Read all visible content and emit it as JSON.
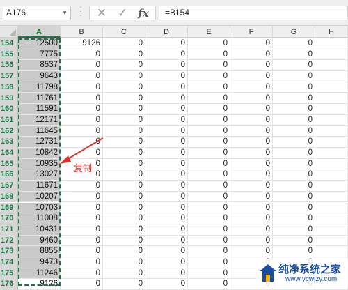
{
  "name_box": {
    "value": "A176",
    "dropdown_icon": "caret-down-icon"
  },
  "formula_bar": {
    "cancel_icon": "x-icon",
    "enter_icon": "checkmark-icon",
    "fx_label": "fx",
    "formula": "=B154"
  },
  "columns": [
    "A",
    "B",
    "C",
    "D",
    "E",
    "F",
    "G",
    "H"
  ],
  "active_column": "A",
  "rows": [
    {
      "num": "154",
      "a": "12500",
      "b": "9126",
      "c": "0",
      "d": "0",
      "e": "0",
      "f": "0",
      "g": "0"
    },
    {
      "num": "155",
      "a": "7775",
      "b": "0",
      "c": "0",
      "d": "0",
      "e": "0",
      "f": "0",
      "g": "0"
    },
    {
      "num": "156",
      "a": "8537",
      "b": "0",
      "c": "0",
      "d": "0",
      "e": "0",
      "f": "0",
      "g": "0"
    },
    {
      "num": "157",
      "a": "9643",
      "b": "0",
      "c": "0",
      "d": "0",
      "e": "0",
      "f": "0",
      "g": "0"
    },
    {
      "num": "158",
      "a": "11798",
      "b": "0",
      "c": "0",
      "d": "0",
      "e": "0",
      "f": "0",
      "g": "0"
    },
    {
      "num": "159",
      "a": "11761",
      "b": "0",
      "c": "0",
      "d": "0",
      "e": "0",
      "f": "0",
      "g": "0"
    },
    {
      "num": "160",
      "a": "11591",
      "b": "0",
      "c": "0",
      "d": "0",
      "e": "0",
      "f": "0",
      "g": "0"
    },
    {
      "num": "161",
      "a": "12171",
      "b": "0",
      "c": "0",
      "d": "0",
      "e": "0",
      "f": "0",
      "g": "0"
    },
    {
      "num": "162",
      "a": "11645",
      "b": "0",
      "c": "0",
      "d": "0",
      "e": "0",
      "f": "0",
      "g": "0"
    },
    {
      "num": "163",
      "a": "12731",
      "b": "0",
      "c": "0",
      "d": "0",
      "e": "0",
      "f": "0",
      "g": "0"
    },
    {
      "num": "164",
      "a": "10842",
      "b": "0",
      "c": "0",
      "d": "0",
      "e": "0",
      "f": "0",
      "g": "0"
    },
    {
      "num": "165",
      "a": "10935",
      "b": "0",
      "c": "0",
      "d": "0",
      "e": "0",
      "f": "0",
      "g": "0"
    },
    {
      "num": "166",
      "a": "13027",
      "b": "0",
      "c": "0",
      "d": "0",
      "e": "0",
      "f": "0",
      "g": "0"
    },
    {
      "num": "167",
      "a": "11671",
      "b": "0",
      "c": "0",
      "d": "0",
      "e": "0",
      "f": "0",
      "g": "0"
    },
    {
      "num": "168",
      "a": "10207",
      "b": "0",
      "c": "0",
      "d": "0",
      "e": "0",
      "f": "0",
      "g": "0"
    },
    {
      "num": "169",
      "a": "10703",
      "b": "0",
      "c": "0",
      "d": "0",
      "e": "0",
      "f": "0",
      "g": "0"
    },
    {
      "num": "170",
      "a": "11008",
      "b": "0",
      "c": "0",
      "d": "0",
      "e": "0",
      "f": "0",
      "g": "0"
    },
    {
      "num": "171",
      "a": "10431",
      "b": "0",
      "c": "0",
      "d": "0",
      "e": "0",
      "f": "0",
      "g": "0"
    },
    {
      "num": "172",
      "a": "9460",
      "b": "0",
      "c": "0",
      "d": "0",
      "e": "0",
      "f": "0",
      "g": "0"
    },
    {
      "num": "173",
      "a": "8855",
      "b": "0",
      "c": "0",
      "d": "0",
      "e": "0",
      "f": "0",
      "g": "0"
    },
    {
      "num": "174",
      "a": "9473",
      "b": "0",
      "c": "0",
      "d": "0",
      "e": "0",
      "f": "0",
      "g": "0"
    },
    {
      "num": "175",
      "a": "11246",
      "b": "0",
      "c": "0",
      "d": "0",
      "e": "0",
      "f": "0",
      "g": "0"
    },
    {
      "num": "176",
      "a": "9126",
      "b": "0",
      "c": "0",
      "d": "0",
      "e": "0",
      "f": "0",
      "g": "0"
    }
  ],
  "annotation": {
    "label": "复制",
    "color": "#e0312b",
    "arrow_icon": "arrow-left-icon"
  },
  "watermark": {
    "title": "纯净系统之家",
    "url": "www.ycwjzy.com",
    "logo_icon": "house-logo-icon"
  },
  "colors": {
    "accent": "#217346",
    "selection_fill": "#c9c9c9"
  }
}
